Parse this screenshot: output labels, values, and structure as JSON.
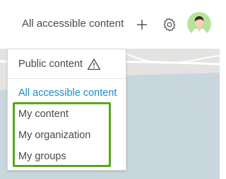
{
  "header": {
    "scope_selector_label": "All accessible content",
    "add_icon": "plus-icon",
    "settings_icon": "gear-icon",
    "avatar_icon": "user-avatar"
  },
  "dropdown": {
    "items": [
      {
        "label": "Public content",
        "icon": "warning-icon",
        "selected": false
      },
      {
        "label": "All accessible content",
        "selected": true
      },
      {
        "label": "My content",
        "selected": false
      },
      {
        "label": "My organization",
        "selected": false
      },
      {
        "label": "My groups",
        "selected": false
      }
    ]
  },
  "colors": {
    "selected_text": "#1b8ad1",
    "highlight": "#5aa51b",
    "text": "#4a4a4a",
    "map_background": "#e4e3e1",
    "map_water": "#c8d6dd"
  }
}
